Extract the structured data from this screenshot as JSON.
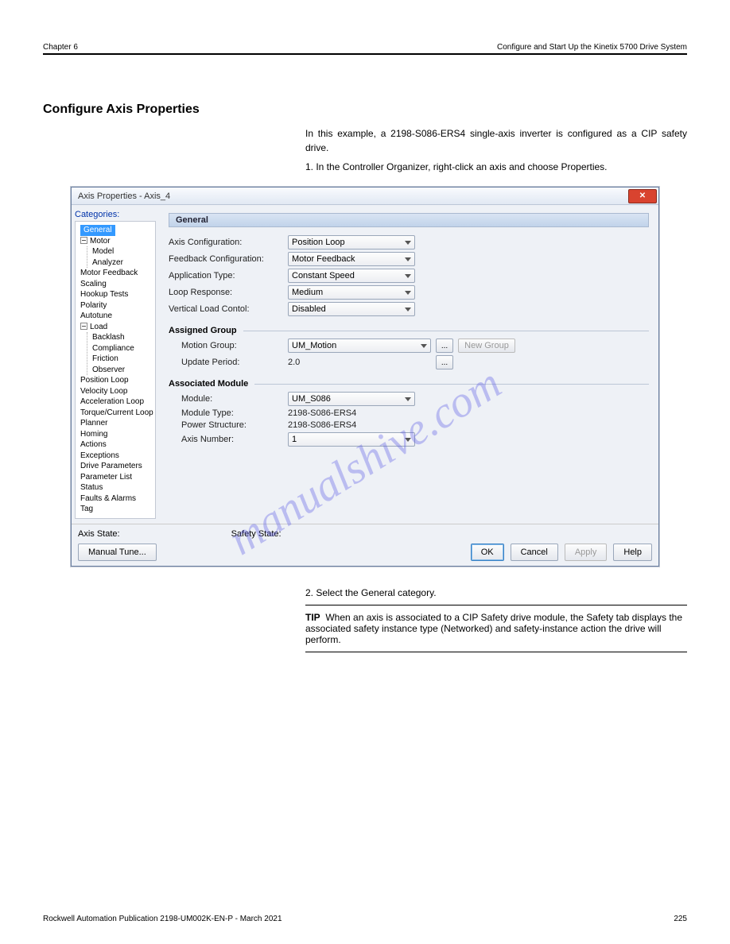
{
  "page_header": {
    "left": "Chapter 6",
    "right": "Configure and Start Up the Kinetix 5700 Drive System"
  },
  "watermark": "manualshive.com",
  "intro": {
    "title": "Configure Axis Properties",
    "p1": "In this example, a 2198-S086-ERS4 single-axis inverter is configured as a CIP safety drive.",
    "step": "1.    In the Controller Organizer, right-click an axis and choose Properties."
  },
  "dialog": {
    "title": "Axis Properties - Axis_4",
    "categories_label": "Categories:",
    "tree": {
      "selected": "General",
      "items": [
        "General",
        "Motor",
        "Model",
        "Analyzer",
        "Motor Feedback",
        "Scaling",
        "Hookup Tests",
        "Polarity",
        "Autotune",
        "Load",
        "Backlash",
        "Compliance",
        "Friction",
        "Observer",
        "Position Loop",
        "Velocity Loop",
        "Acceleration Loop",
        "Torque/Current Loop",
        "Planner",
        "Homing",
        "Actions",
        "Exceptions",
        "Drive Parameters",
        "Parameter List",
        "Status",
        "Faults & Alarms",
        "Tag"
      ]
    },
    "panel_title": "General",
    "fields": {
      "axis_config": {
        "label": "Axis Configuration:",
        "value": "Position Loop"
      },
      "feedback_config": {
        "label": "Feedback Configuration:",
        "value": "Motor Feedback"
      },
      "application_type": {
        "label": "Application Type:",
        "value": "Constant Speed"
      },
      "loop_response": {
        "label": "Loop Response:",
        "value": "Medium"
      },
      "vertical_load": {
        "label": "Vertical Load Contol:",
        "value": "Disabled"
      }
    },
    "assigned_group": {
      "heading": "Assigned Group",
      "motion_group": {
        "label": "Motion Group:",
        "value": "UM_Motion"
      },
      "browse": "...",
      "new_group": "New Group",
      "update_period": {
        "label": "Update Period:",
        "value": "2.0"
      },
      "browse2": "..."
    },
    "associated_module": {
      "heading": "Associated Module",
      "module": {
        "label": "Module:",
        "value": "UM_S086"
      },
      "module_type": {
        "label": "Module Type:",
        "value": "2198-S086-ERS4"
      },
      "power_structure": {
        "label": "Power Structure:",
        "value": "2198-S086-ERS4"
      },
      "axis_number": {
        "label": "Axis Number:",
        "value": "1"
      }
    },
    "footer": {
      "axis_state": "Axis State:",
      "safety_state": "Safety State:",
      "manual_tune": "Manual Tune...",
      "ok": "OK",
      "cancel": "Cancel",
      "apply": "Apply",
      "help": "Help"
    }
  },
  "step2": "2.    Select the General category.",
  "tip": {
    "label": "TIP",
    "text": "When an axis is associated to a CIP Safety drive module, the Safety tab displays the associated safety instance type (Networked) and safety-instance action the drive will perform."
  },
  "page_footer": {
    "left": "Rockwell Automation Publication 2198-UM002K-EN-P - March 2021",
    "right": "225"
  }
}
